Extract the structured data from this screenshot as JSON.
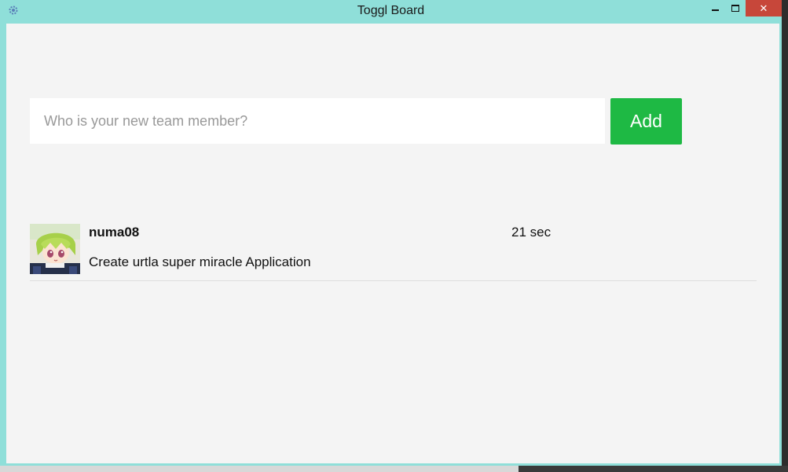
{
  "window": {
    "title": "Toggl Board",
    "controls": {
      "minimize_icon": "minimize-icon",
      "maximize_icon": "maximize-icon",
      "close_label": "✕"
    },
    "colors": {
      "frame": "#8fdfd9",
      "close": "#c7473a",
      "client_bg": "#f4f4f4"
    }
  },
  "add_member": {
    "placeholder": "Who is your new team member?",
    "value": "",
    "button_label": "Add",
    "button_color": "#1eb944"
  },
  "members": [
    {
      "name": "numa08",
      "elapsed": "21 sec",
      "task": "Create urtla super miracle Application",
      "avatar_icon": "anime-avatar-icon"
    }
  ]
}
